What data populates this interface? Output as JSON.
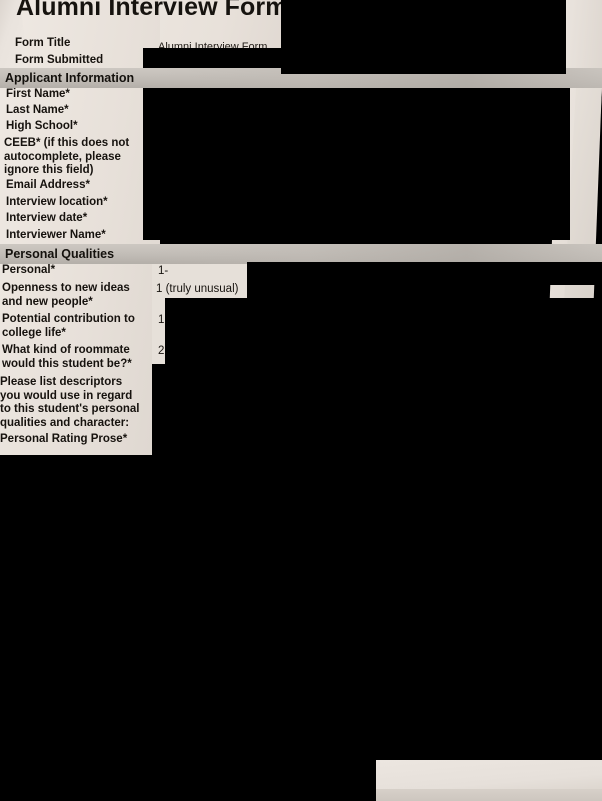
{
  "document": {
    "title": "Alumni Interview Form",
    "type": "scanned-form-photograph",
    "paper_color": "#e9e3dd",
    "redaction_color": "#000000",
    "band_color": "#c2bdb7"
  },
  "fields": [
    {
      "label": "Form Title",
      "value": "Alumni Interview Form",
      "redacted": false
    },
    {
      "label": "Form Submitted",
      "value": "",
      "redacted": true
    }
  ],
  "sections": [
    {
      "heading": "Applicant Information",
      "fields": [
        {
          "label": "First Name*",
          "value": "",
          "redacted": true
        },
        {
          "label": "Last Name*",
          "value": "",
          "redacted": true
        },
        {
          "label": "High School*",
          "value": "",
          "redacted": true
        },
        {
          "label": "CEEB* (if this does not\nautocomplete, please\nignore this field)",
          "value": "",
          "redacted": true
        },
        {
          "label": "Email Address*",
          "value": "",
          "redacted": true
        },
        {
          "label": "Interview location*",
          "value": "",
          "redacted": true
        },
        {
          "label": "Interview date*",
          "value": "",
          "redacted": true
        },
        {
          "label": "Interviewer Name*",
          "value": "",
          "redacted": true
        }
      ]
    },
    {
      "heading": "Personal Qualities",
      "fields": [
        {
          "label": "Personal*",
          "value": "1-",
          "redacted": false
        },
        {
          "label": "Openness to new ideas\nand new people*",
          "value": "1 (truly unusual)",
          "redacted": false
        },
        {
          "label": "Potential contribution to\ncollege life*",
          "value": "1",
          "redacted": false
        },
        {
          "label": "What kind of roommate\nwould this student be?*",
          "value": "2",
          "redacted": false
        },
        {
          "label": "Please list descriptors\nyou would use in regard\nto this student's personal\nqualities and character:",
          "value": "",
          "redacted": true
        },
        {
          "label": "Personal Rating Prose*",
          "value": "",
          "redacted": true
        }
      ]
    }
  ]
}
